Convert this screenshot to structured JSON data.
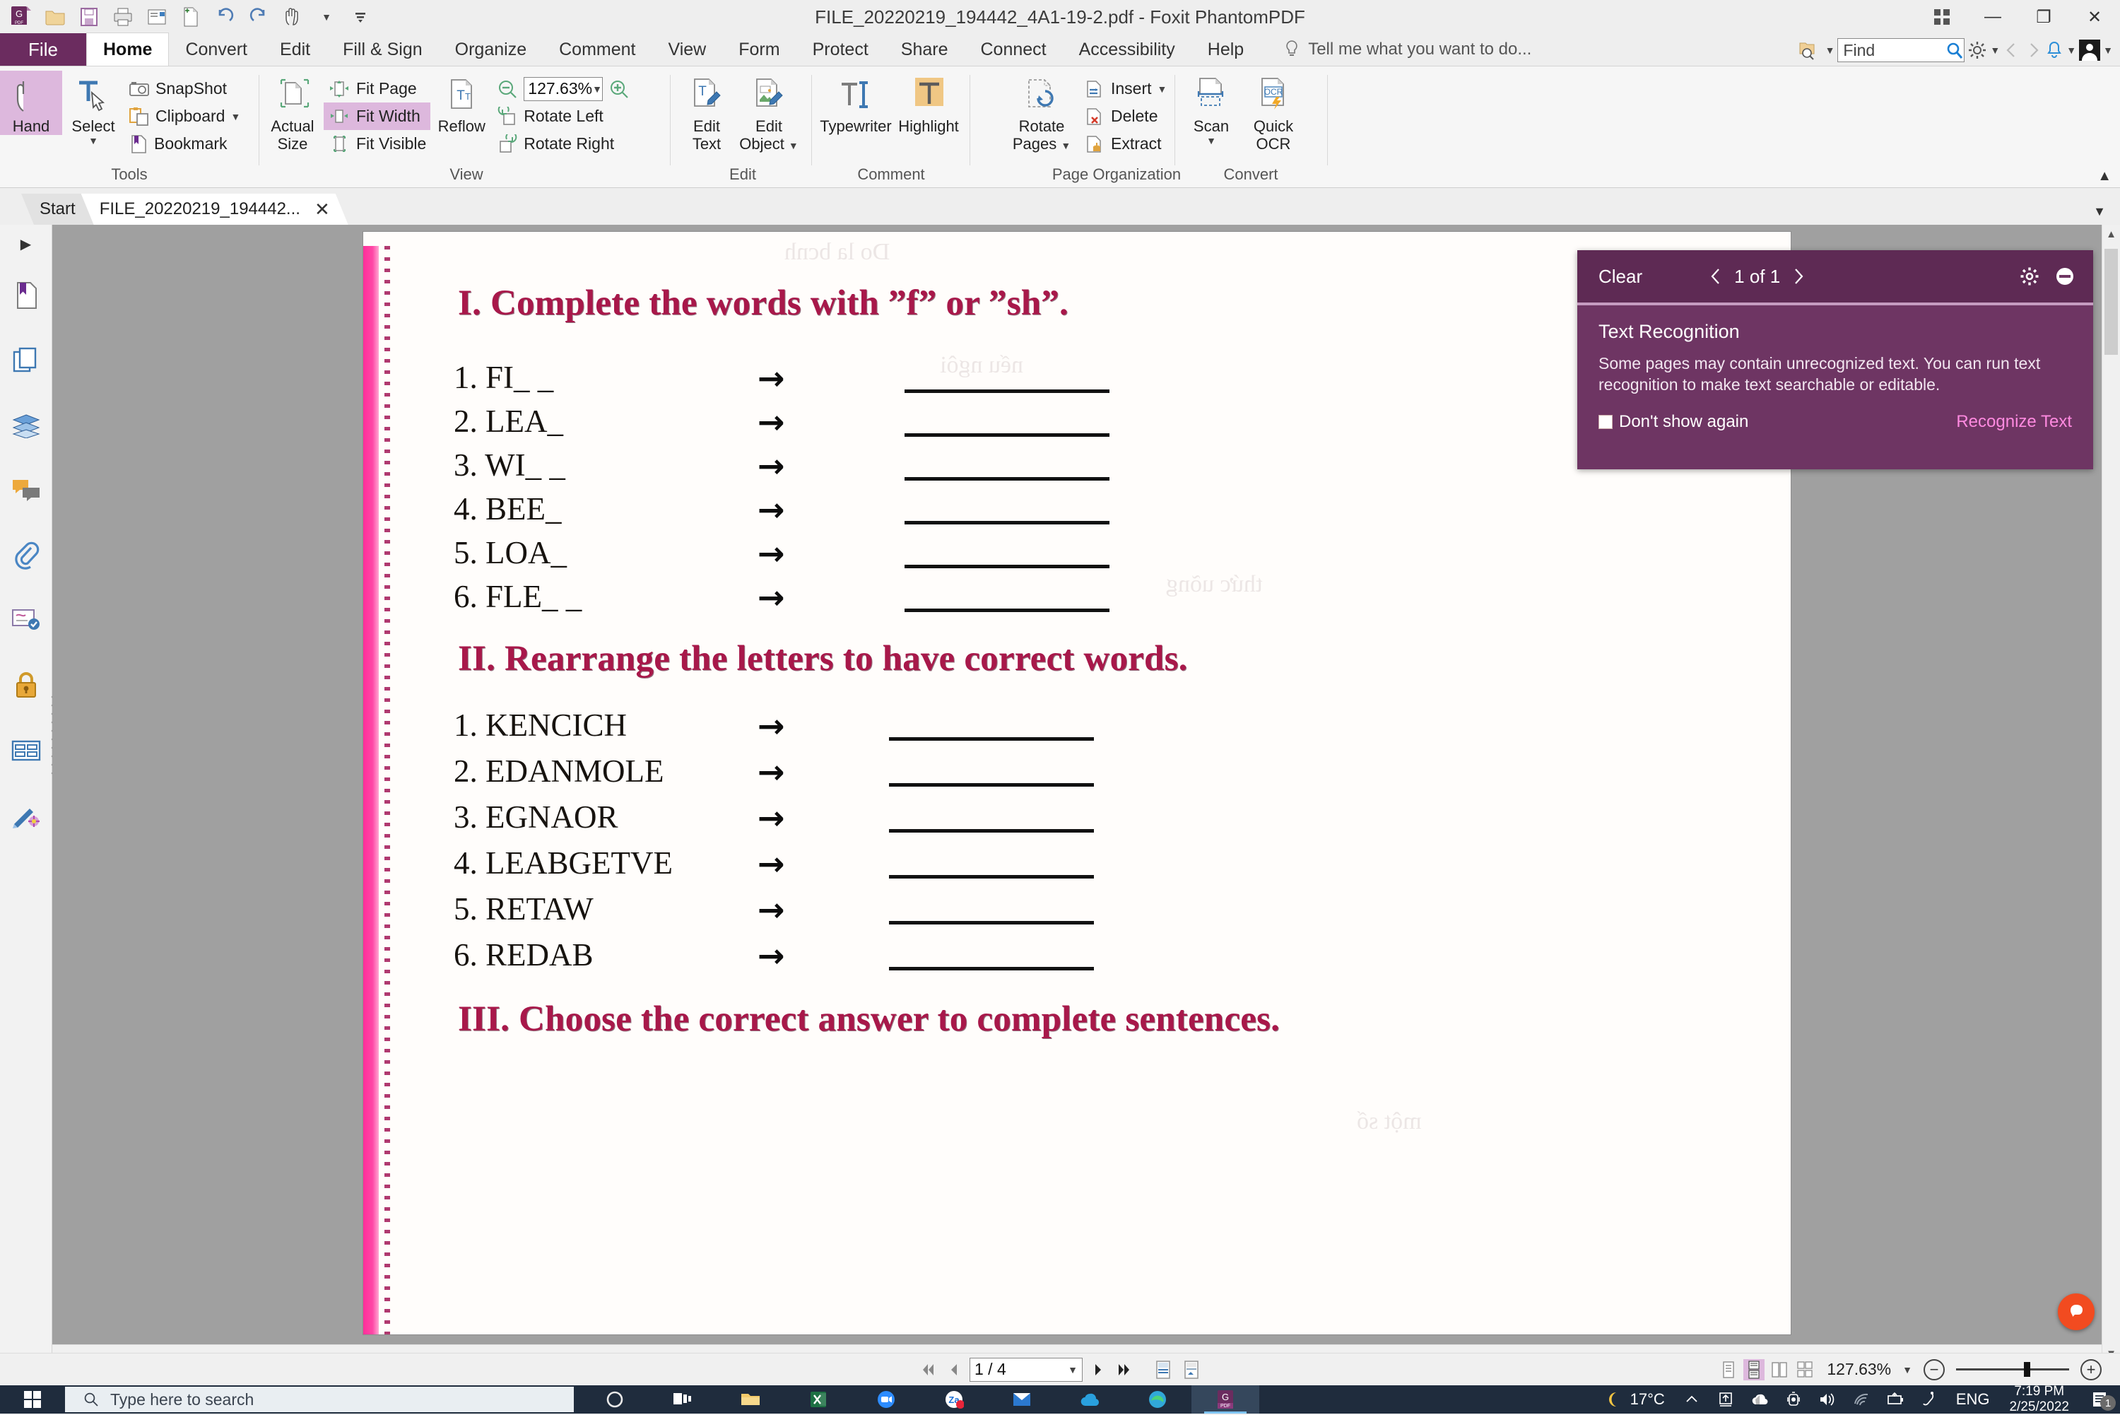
{
  "window": {
    "title": "FILE_20220219_194442_4A1-19-2.pdf - Foxit PhantomPDF",
    "quick_access": [
      "app-logo-icon",
      "open-folder-icon",
      "save-icon",
      "print-icon",
      "email-icon",
      "new-from-file-icon",
      "undo-icon",
      "redo-icon",
      "hand-tool-icon",
      "qat-dropdown-icon",
      "qat-customize-icon"
    ],
    "controls": {
      "grid": "grid-icon",
      "minimize": "—",
      "maximize": "❐",
      "close": "✕"
    }
  },
  "menu": {
    "file_label": "File",
    "tabs": [
      "Home",
      "Convert",
      "Edit",
      "Fill & Sign",
      "Organize",
      "Comment",
      "View",
      "Form",
      "Protect",
      "Share",
      "Connect",
      "Accessibility",
      "Help"
    ],
    "active_tab": "Home",
    "tell_me": "Tell me what you want to do...",
    "find_placeholder": "Find",
    "find_value": ""
  },
  "ribbon": {
    "groups": [
      {
        "label": "Tools",
        "big": [
          {
            "label": "Hand",
            "icon": "hand-icon",
            "selected": true
          },
          {
            "label": "Select",
            "icon": "select-text-icon",
            "dropdown": true
          }
        ],
        "small": [
          {
            "label": "SnapShot",
            "icon": "camera-icon"
          },
          {
            "label": "Clipboard",
            "icon": "clipboard-icon",
            "dropdown": true
          },
          {
            "label": "Bookmark",
            "icon": "bookmark-icon"
          }
        ]
      },
      {
        "label": "View",
        "big": [
          {
            "label": "Actual\nSize",
            "icon": "actual-size-icon"
          }
        ],
        "small": [
          {
            "label": "Fit Page",
            "icon": "fit-page-icon"
          },
          {
            "label": "Fit Width",
            "icon": "fit-width-icon",
            "selected": true
          },
          {
            "label": "Fit Visible",
            "icon": "fit-visible-icon"
          }
        ],
        "big2": [
          {
            "label": "Reflow",
            "icon": "reflow-icon"
          }
        ],
        "zoom_value": "127.63%",
        "small2": [
          {
            "label": "Rotate Left",
            "icon": "rotate-left-icon"
          },
          {
            "label": "Rotate Right",
            "icon": "rotate-right-icon"
          }
        ]
      },
      {
        "label": "Edit",
        "big": [
          {
            "label": "Edit\nText",
            "icon": "edit-text-icon"
          },
          {
            "label": "Edit\nObject",
            "icon": "edit-object-icon",
            "dropdown": true
          }
        ]
      },
      {
        "label": "Comment",
        "big": [
          {
            "label": "Typewriter",
            "icon": "typewriter-icon"
          },
          {
            "label": "Highlight",
            "icon": "highlight-icon"
          }
        ]
      },
      {
        "label": "Page Organization",
        "big": [
          {
            "label": "Rotate\nPages",
            "icon": "rotate-pages-icon",
            "dropdown": true
          }
        ],
        "small": [
          {
            "label": "Insert",
            "icon": "insert-page-icon",
            "dropdown": true
          },
          {
            "label": "Delete",
            "icon": "delete-page-icon"
          },
          {
            "label": "Extract",
            "icon": "extract-page-icon"
          }
        ]
      },
      {
        "label": "Convert",
        "big": [
          {
            "label": "Scan",
            "icon": "scan-icon",
            "dropdown": true
          },
          {
            "label": "Quick\nOCR",
            "icon": "ocr-icon"
          }
        ]
      }
    ]
  },
  "doc_tabs": [
    {
      "label": "Start",
      "active": false,
      "closable": false
    },
    {
      "label": "FILE_20220219_194442...",
      "active": true,
      "closable": true,
      "close_label": "✕"
    }
  ],
  "rail": {
    "expand_icon": "expand-panel-icon",
    "items": [
      "bookmark-panel-icon",
      "pages-panel-icon",
      "layers-panel-icon",
      "comments-panel-icon",
      "attachments-panel-icon",
      "signatures-panel-icon",
      "security-panel-icon",
      "fields-panel-icon",
      "stamps-panel-icon"
    ]
  },
  "document": {
    "sections": [
      {
        "heading": "I. Complete the words with ”f” or ”sh”.",
        "items": [
          "1. FI_ _",
          "2. LEA_",
          "3. WI_ _",
          "4. BEE_",
          "5. LOA_",
          "6. FLE_ _"
        ],
        "arrow": "→"
      },
      {
        "heading": "II. Rearrange the letters to have correct words.",
        "items": [
          "1. KENCICH",
          "2. EDANMOLE",
          "3. EGNAOR",
          "4. LEABGETVE",
          "5. RETAW",
          "6. REDAB"
        ],
        "arrow": "→"
      },
      {
        "heading": "III. Choose the correct answer to complete sentences.",
        "items": [],
        "arrow": "→"
      }
    ],
    "bleed_ghost_text": [
      "Do la bcnh",
      "nếu ngôi",
      "thức uõng",
      "một số"
    ]
  },
  "ocr_panel": {
    "clear_label": "Clear",
    "prev_icon": "chevron-left-icon",
    "counter": "1 of 1",
    "next_icon": "chevron-right-icon",
    "settings_icon": "gear-icon",
    "collapse_icon": "minus-circle-icon",
    "title": "Text Recognition",
    "description": "Some pages may contain unrecognized text. You can run text recognition to make text searchable or editable.",
    "dont_show_label": "Don't show again",
    "dont_show_checked": false,
    "action_link": "Recognize Text",
    "link_color": "#ff8ae0"
  },
  "statusbar": {
    "first_page_icon": "first-page-icon",
    "prev_page_icon": "prev-page-icon",
    "page_value": "1 / 4",
    "next_page_icon": "next-page-icon",
    "last_page_icon": "last-page-icon",
    "fit_page_icon": "page-fit-icon",
    "fit_width_icon": "page-width-icon",
    "view_modes": [
      "single-page-icon",
      "continuous-page-icon",
      "facing-page-icon",
      "continuous-facing-icon"
    ],
    "active_view_mode": 1,
    "zoom_value": "127.63%",
    "zoom_out": "−",
    "zoom_in": "+",
    "help_fab_icon": "foxit-help-icon"
  },
  "taskbar": {
    "start_icon": "windows-start-icon",
    "search_placeholder": "Type here to search",
    "search_icon": "search-icon",
    "apps": [
      "cortana-icon",
      "task-view-icon",
      "file-explorer-icon",
      "excel-icon",
      "zoom-meetings-icon",
      "mail-icon",
      "zalo-icon",
      "onedrive-icon",
      "edge-icon",
      "foxit-pdf-icon"
    ],
    "active_app": "foxit-pdf-icon",
    "tray": {
      "weather_icon": "moon-icon",
      "temperature": "17°C",
      "overflow_icon": "chevron-up-icon",
      "icons": [
        "update-icon",
        "onedrive-tray-icon",
        "camera-tray-icon",
        "volume-icon",
        "wifi-icon",
        "battery-icon",
        "pen-icon"
      ],
      "language": "ENG",
      "time": "7:19 PM",
      "date": "2/25/2022",
      "notifications_icon": "action-center-icon",
      "notifications_count": "1"
    }
  },
  "colors": {
    "brand_purple": "#6b2c5f",
    "ribbon_selected": "#ddb8dd",
    "heading_red": "#a8184a",
    "page_edge_pink": "#ff2f9a",
    "taskbar": "#1f2c3d",
    "fab_orange": "#f24b20"
  }
}
